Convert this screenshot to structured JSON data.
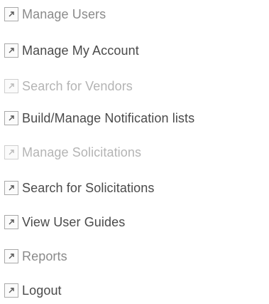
{
  "menu": {
    "items": [
      {
        "label": "Manage Users",
        "tone": "mid"
      },
      {
        "label": "Manage My Account",
        "tone": "dark"
      },
      {
        "label": "Search for Vendors",
        "tone": "faint"
      },
      {
        "label": "Build/Manage Notification lists",
        "tone": "dark"
      },
      {
        "label": "Manage Solicitations",
        "tone": "faint"
      },
      {
        "label": "Search for Solicitations",
        "tone": "dark"
      },
      {
        "label": "View User Guides",
        "tone": "dark"
      },
      {
        "label": "Reports",
        "tone": "mid"
      },
      {
        "label": "Logout",
        "tone": "dark"
      }
    ],
    "icon": "external-link-arrow-icon",
    "colors": {
      "text_dark": "#4a4a4a",
      "text_mid": "#8a8a8a",
      "text_faint": "#b4b4b4"
    }
  }
}
